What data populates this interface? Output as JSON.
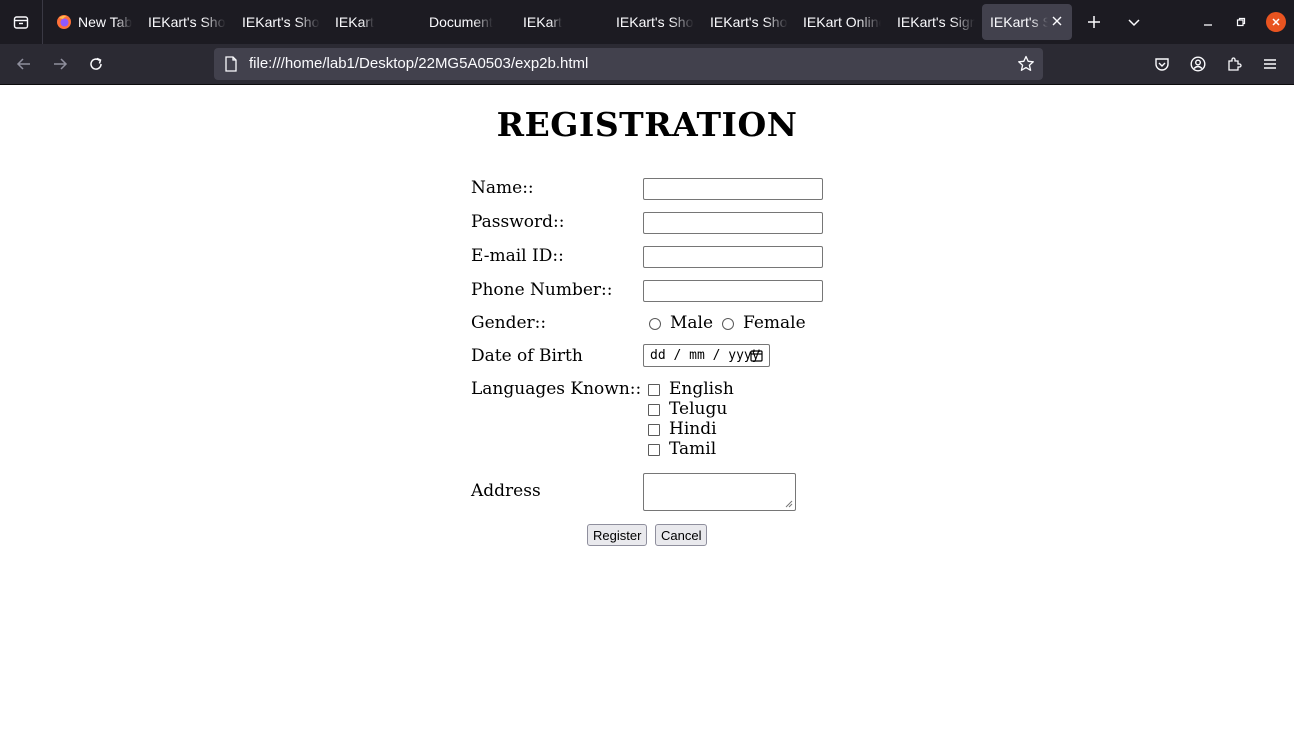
{
  "browser": {
    "tabs": [
      {
        "label": "New Tab",
        "favicon": "firefox-icon"
      },
      {
        "label": "IEKart's Shopping"
      },
      {
        "label": "IEKart's Shopping"
      },
      {
        "label": "IEKart"
      },
      {
        "label": "Document"
      },
      {
        "label": "IEKart"
      },
      {
        "label": "IEKart's Shopping"
      },
      {
        "label": "IEKart's Shopping"
      },
      {
        "label": "IEKart Online"
      },
      {
        "label": "IEKart's Sign"
      },
      {
        "label": "IEKart's Shopping",
        "active": true
      }
    ],
    "url": "file:///home/lab1/Desktop/22MG5A0503/exp2b.html",
    "colors": {
      "tabbar": "#1c1b22",
      "navbar": "#2b2a33",
      "urlbar": "#42414d",
      "close_button": "#e95420"
    }
  },
  "page": {
    "heading": "REGISTRATION",
    "labels": {
      "name": "Name::",
      "password": "Password::",
      "email": "E-mail ID::",
      "phone": "Phone Number::",
      "gender": "Gender::",
      "dob": "Date of Birth",
      "languages": "Languages Known::",
      "address": "Address"
    },
    "fields": {
      "name": "",
      "password": "",
      "email": "",
      "phone": "",
      "address": ""
    },
    "gender_options": [
      "Male",
      "Female"
    ],
    "dob_placeholder": "dd / mm / yyyy",
    "languages": [
      "English",
      "Telugu",
      "Hindi",
      "Tamil"
    ],
    "buttons": {
      "register": "Register",
      "cancel": "Cancel"
    }
  }
}
